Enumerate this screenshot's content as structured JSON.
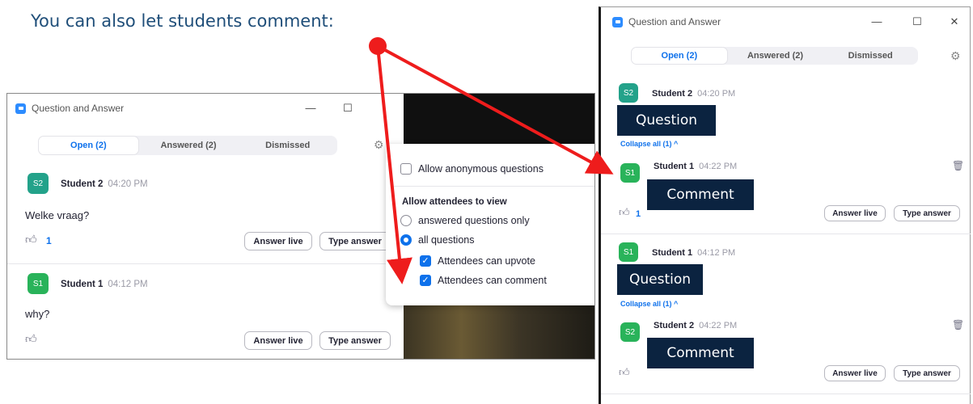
{
  "caption": "You can also let students comment:",
  "colors": {
    "accent": "#0e71eb",
    "arrow": "#ee1c1c",
    "overlay": "#0b2340"
  },
  "left_window": {
    "title": "Question and Answer",
    "controls": {
      "minimize": "—",
      "maximize": "☐",
      "close": "✕"
    },
    "tabs": [
      {
        "label": "Open (2)",
        "active": true
      },
      {
        "label": "Answered (2)",
        "active": false
      },
      {
        "label": "Dismissed",
        "active": false
      }
    ],
    "gear_icon": "⚙",
    "questions": [
      {
        "avatar": "S2",
        "name": "Student 2",
        "time": "04:20 PM",
        "text": "Welke vraag?",
        "likes": "1"
      },
      {
        "avatar": "S1",
        "name": "Student 1",
        "time": "04:12 PM",
        "text": "why?",
        "likes": ""
      }
    ],
    "answer_live": "Answer live",
    "type_answer": "Type answer",
    "settings": {
      "allow_anonymous": "Allow anonymous questions",
      "view_header": "Allow attendees to view",
      "answered_only": "answered questions only",
      "all_questions": "all questions",
      "can_upvote": "Attendees can upvote",
      "can_comment": "Attendees can comment"
    }
  },
  "right_window": {
    "title": "Question and Answer",
    "controls": {
      "minimize": "—",
      "maximize": "☐",
      "close": "✕"
    },
    "tabs": [
      {
        "label": "Open (2)",
        "active": true
      },
      {
        "label": "Answered (2)",
        "active": false
      },
      {
        "label": "Dismissed",
        "active": false
      }
    ],
    "gear_icon": "⚙",
    "threads": [
      {
        "question": {
          "avatar": "S2",
          "name": "Student 2",
          "time": "04:20 PM",
          "overlay": "Question"
        },
        "collapse": "Collapse all (1) ^",
        "comment": {
          "avatar": "S1",
          "name": "Student 1",
          "time": "04:22 PM",
          "overlay": "Comment"
        },
        "likes": "1"
      },
      {
        "question": {
          "avatar": "S1",
          "name": "Student 1",
          "time": "04:12 PM",
          "overlay": "Question"
        },
        "collapse": "Collapse all (1) ^",
        "comment": {
          "avatar": "S2",
          "name": "Student 2",
          "time": "04:22 PM",
          "overlay": "Comment"
        },
        "likes": ""
      }
    ],
    "answer_live": "Answer live",
    "type_answer": "Type answer",
    "trash_icon": "🗑"
  }
}
